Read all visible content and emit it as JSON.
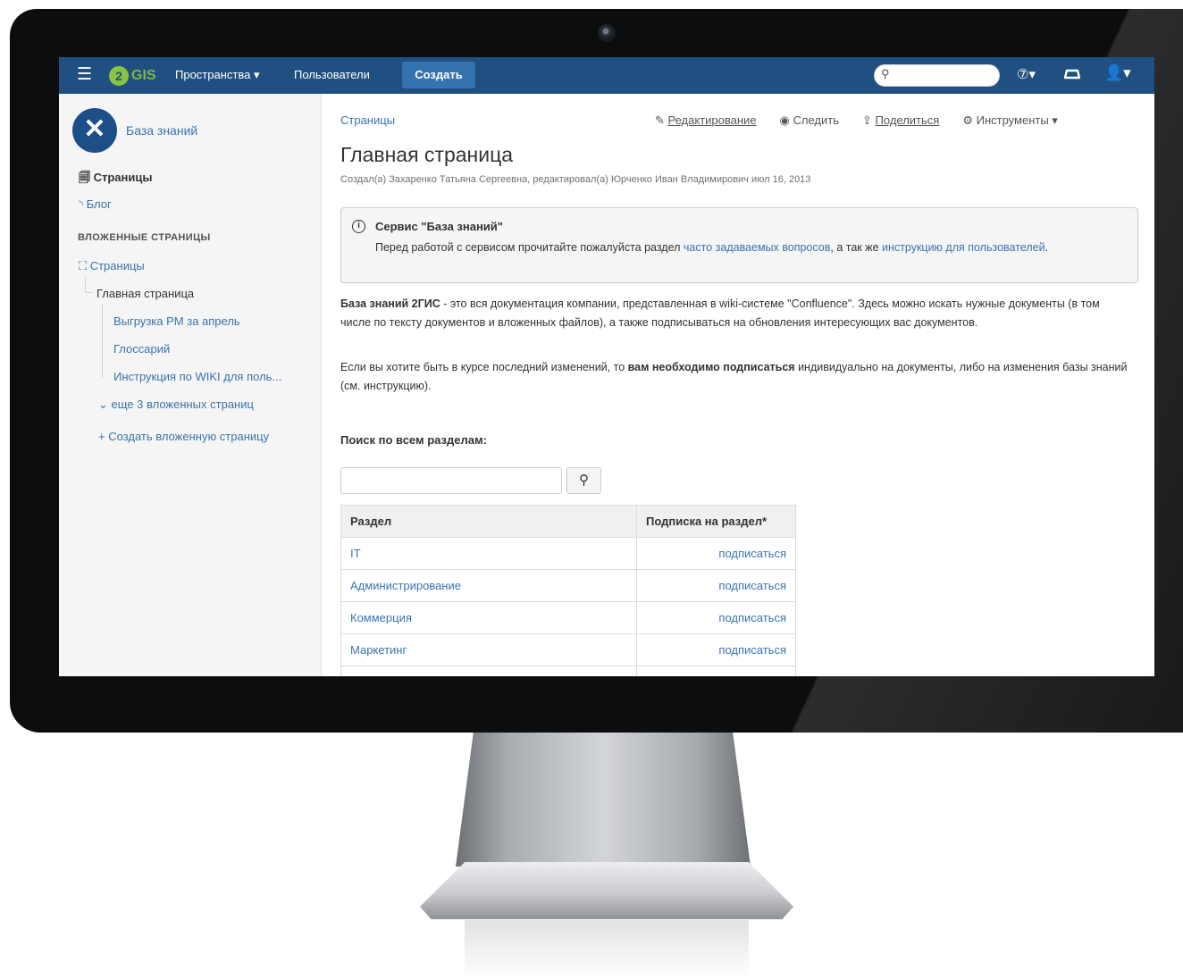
{
  "topbar": {
    "logo_glyph": "2",
    "logo_text": "GIS",
    "spaces_label": "Пространства ▾",
    "users_label": "Пользователи",
    "create_label": "Создать",
    "search_icon": "⚲",
    "help_icon": "⑦▾",
    "avatar_icon": "👤▾"
  },
  "sidebar": {
    "space_name": "База знаний",
    "pages_label": "Страницы",
    "blog_label": "Блог",
    "nested_heading": "ВЛОЖЕННЫЕ СТРАНИЦЫ",
    "tree_root_label": "Страницы",
    "main_page_label": "Главная страница",
    "children": [
      "Выгрузка PM за апрель",
      "Глоссарий",
      "Инструкция по WIKI для поль..."
    ],
    "more_label": "еще 3 вложенных страниц",
    "create_child_label": "Создать вложенную страницу"
  },
  "content": {
    "breadcrumb": "Страницы",
    "actions": {
      "edit": "Редактирование",
      "watch": "Следить",
      "share": "Поделиться",
      "tools": "Инструменты ▾"
    },
    "title": "Главная страница",
    "byline": "Создал(а) Захаренко Татьяна Сергеевна, редактировал(а) Юрченко Иван Владимирович июл 16, 2013",
    "info": {
      "title": "Сервис \"База знаний\"",
      "text_before": "Перед работой с сервисом прочитайте пожалуйста раздел ",
      "link1": "часто задаваемых вопросов",
      "text_middle": ", а так же ",
      "link2": "инструкцию для пользователей",
      "text_after": "."
    },
    "para1_bold": "База знаний 2ГИС",
    "para1_rest": " - это вся документация компании, представленная в wiki-системе \"Confluence\". Здесь можно искать нужные документы (в том числе по тексту документов и вложенных файлов), а также подписываться на обновления интересующих вас документов.",
    "para2_before": "Если вы хотите быть в курсе последний изменений, то ",
    "para2_bold": "вам необходимо подписаться",
    "para2_after": " индивидуально на документы, либо на изменения базы знаний (см. инструкцию).",
    "search_heading": "Поиск по всем разделам:",
    "search_icon": "⚲",
    "table": {
      "headers": [
        "Раздел",
        "Подписка на раздел*"
      ],
      "rows": [
        [
          "IT",
          "подписаться"
        ],
        [
          "Администрирование",
          "подписаться"
        ],
        [
          "Коммерция",
          "подписаться"
        ],
        [
          "Маркетинг",
          "подписаться"
        ],
        [
          "",
          ""
        ]
      ]
    }
  }
}
